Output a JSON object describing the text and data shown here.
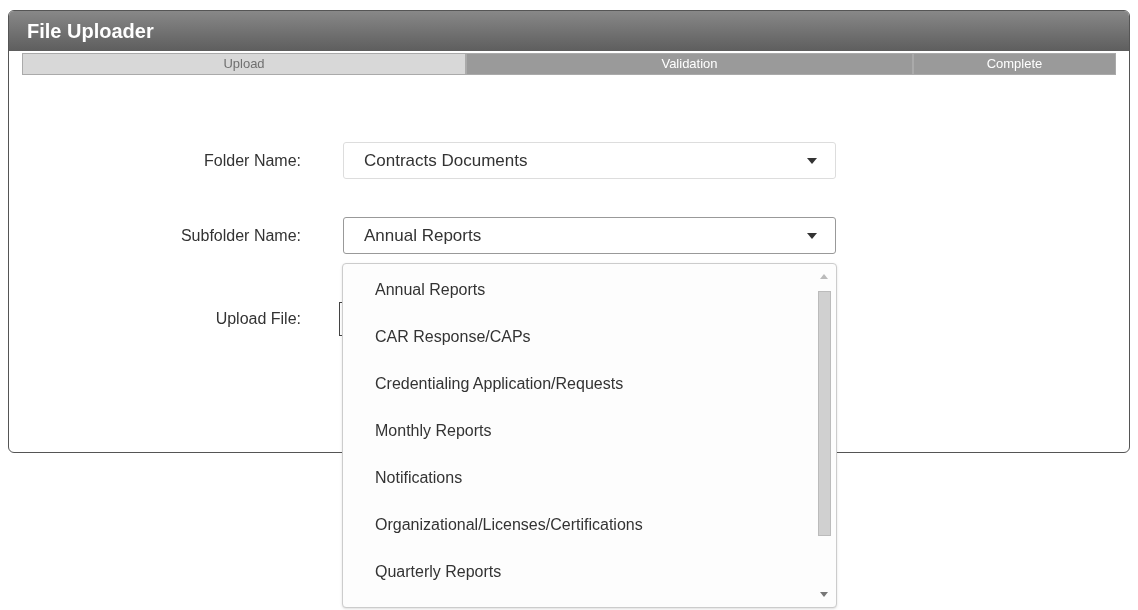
{
  "panel": {
    "title": "File Uploader"
  },
  "steps": [
    {
      "label": "Upload",
      "selected": true
    },
    {
      "label": "Validation",
      "selected": false
    },
    {
      "label": "Complete",
      "selected": false
    }
  ],
  "form": {
    "folder": {
      "label": "Folder Name:",
      "value": "Contracts Documents"
    },
    "subfolder": {
      "label": "Subfolder Name:",
      "value": "Annual Reports",
      "expanded": true
    },
    "upload": {
      "label": "Upload File:"
    }
  },
  "dropdown_options": [
    "Annual Reports",
    "CAR Response/CAPs",
    "Credentialing Application/Requests",
    "Monthly Reports",
    "Notifications",
    "Organizational/Licenses/Certifications",
    "Quarterly Reports"
  ]
}
